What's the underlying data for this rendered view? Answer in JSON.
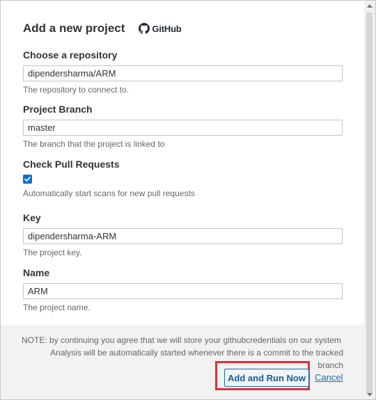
{
  "dialog": {
    "title": "Add a new project",
    "provider_label": "GitHub",
    "provider_icon": "github-icon"
  },
  "fields": {
    "repository": {
      "label": "Choose a repository",
      "value": "dipendersharma/ARM",
      "help": "The repository to connect to."
    },
    "branch": {
      "label": "Project Branch",
      "value": "master",
      "help": "The branch that the project is linked to"
    },
    "pull_requests": {
      "label": "Check Pull Requests",
      "checked": true,
      "help": "Automatically start scans for new pull requests"
    },
    "key": {
      "label": "Key",
      "value": "dipendersharma-ARM",
      "help": "The project key."
    },
    "name": {
      "label": "Name",
      "value": "ARM",
      "help": "The project name."
    }
  },
  "footer": {
    "note_line1": "NOTE: by continuing you agree that we will store your githubcredentials on our system",
    "note_line2": "Analysis will be automatically started whenever there is a commit to the tracked",
    "note_line3": "branch",
    "primary_button": "Add and Run Now",
    "cancel_link": "Cancel"
  },
  "colors": {
    "primary": "#1c6aa3",
    "checkbox": "#0a6ed1",
    "highlight": "#e0313a"
  }
}
